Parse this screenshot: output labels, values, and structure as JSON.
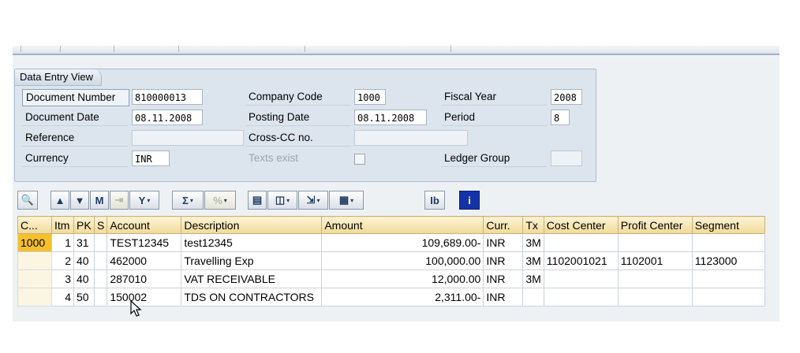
{
  "header": {
    "title": "Data Entry View",
    "labels": {
      "doc_number": "Document Number",
      "doc_date": "Document Date",
      "reference": "Reference",
      "currency": "Currency",
      "company_code": "Company Code",
      "posting_date": "Posting Date",
      "cross_cc": "Cross-CC no.",
      "texts_exist": "Texts exist",
      "fiscal_year": "Fiscal Year",
      "period": "Period",
      "ledger_group": "Ledger Group"
    },
    "values": {
      "doc_number": "810000013",
      "doc_date": "08.11.2008",
      "reference": "",
      "currency": "INR",
      "company_code": "1000",
      "posting_date": "08.11.2008",
      "cross_cc": "",
      "fiscal_year": "2008",
      "period": "8",
      "ledger_group": ""
    }
  },
  "toolbar": {
    "buttons": [
      {
        "name": "details",
        "glyph": "🔍"
      },
      {
        "name": "sort-ascending",
        "glyph": "▲"
      },
      {
        "name": "sort-descending",
        "glyph": "▼"
      },
      {
        "name": "find",
        "glyph": "M"
      },
      {
        "name": "find-next",
        "glyph": "⇥"
      },
      {
        "name": "filter",
        "glyph": "Y"
      },
      {
        "name": "total",
        "glyph": "Σ"
      },
      {
        "name": "subtotal",
        "glyph": "%"
      },
      {
        "name": "print",
        "glyph": "▤"
      },
      {
        "name": "views",
        "glyph": "◫"
      },
      {
        "name": "export",
        "glyph": "⇲"
      },
      {
        "name": "layout",
        "glyph": "▦"
      },
      {
        "name": "choose-layout",
        "glyph": "Ib"
      },
      {
        "name": "information",
        "glyph": "i"
      }
    ]
  },
  "table": {
    "columns": [
      "C...",
      "Itm",
      "PK",
      "S",
      "Account",
      "Description",
      "Amount",
      "Curr.",
      "Tx",
      "Cost Center",
      "Profit Center",
      "Segment"
    ],
    "company_code": "1000",
    "rows": [
      {
        "itm": "1",
        "pk": "31",
        "s": "",
        "account": "TEST12345",
        "description": "test12345",
        "amount": "109,689.00-",
        "curr": "INR",
        "tx": "3M",
        "cost_center": "",
        "profit_center": "",
        "segment": ""
      },
      {
        "itm": "2",
        "pk": "40",
        "s": "",
        "account": "462000",
        "description": "Travelling Exp",
        "amount": "100,000.00",
        "curr": "INR",
        "tx": "3M",
        "cost_center": "1102001021",
        "profit_center": "1102001",
        "segment": "1123000"
      },
      {
        "itm": "3",
        "pk": "40",
        "s": "",
        "account": "287010",
        "description": "VAT RECEIVABLE",
        "amount": "12,000.00",
        "curr": "INR",
        "tx": "3M",
        "cost_center": "",
        "profit_center": "",
        "segment": ""
      },
      {
        "itm": "4",
        "pk": "50",
        "s": "",
        "account": "150002",
        "description": "TDS ON CONTRACTORS",
        "amount": "2,311.00-",
        "curr": "INR",
        "tx": "",
        "cost_center": "",
        "profit_center": "",
        "segment": ""
      }
    ]
  },
  "colors": {
    "header_bg": "#dce5ee",
    "grid_header": "#f1d999",
    "selected_cell": "#f5c02a",
    "info_button": "#1433a8"
  }
}
